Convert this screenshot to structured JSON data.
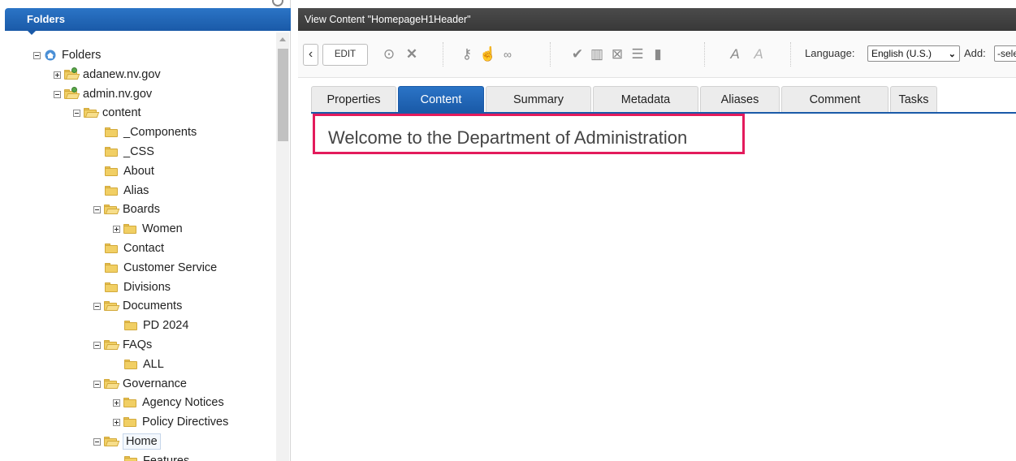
{
  "left_panel": {
    "header": "Folders",
    "tree": [
      {
        "label": "Folders",
        "icon": "home-icon",
        "expander": "minus",
        "level": 0
      },
      {
        "label": "adanew.nv.gov",
        "icon": "site-folder-icon",
        "expander": "plus",
        "level": 1
      },
      {
        "label": "admin.nv.gov",
        "icon": "site-folder-icon",
        "expander": "minus",
        "level": 1
      },
      {
        "label": "content",
        "icon": "folder-open-icon",
        "expander": "minus",
        "level": 2
      },
      {
        "label": "_Components",
        "icon": "folder-icon",
        "expander": "",
        "level": 3
      },
      {
        "label": "_CSS",
        "icon": "folder-icon",
        "expander": "",
        "level": 3
      },
      {
        "label": "About",
        "icon": "folder-icon",
        "expander": "",
        "level": 3
      },
      {
        "label": "Alias",
        "icon": "folder-icon",
        "expander": "",
        "level": 3
      },
      {
        "label": "Boards",
        "icon": "folder-open-icon",
        "expander": "minus",
        "level": 3
      },
      {
        "label": "Women",
        "icon": "folder-icon",
        "expander": "plus",
        "level": 4
      },
      {
        "label": "Contact",
        "icon": "folder-icon",
        "expander": "",
        "level": 3
      },
      {
        "label": "Customer Service",
        "icon": "folder-icon",
        "expander": "",
        "level": 3
      },
      {
        "label": "Divisions",
        "icon": "folder-icon",
        "expander": "",
        "level": 3
      },
      {
        "label": "Documents",
        "icon": "folder-open-icon",
        "expander": "minus",
        "level": 3
      },
      {
        "label": "PD 2024",
        "icon": "folder-icon",
        "expander": "",
        "level": 4
      },
      {
        "label": "FAQs",
        "icon": "folder-open-icon",
        "expander": "minus",
        "level": 3
      },
      {
        "label": "ALL",
        "icon": "folder-icon",
        "expander": "",
        "level": 4
      },
      {
        "label": "Governance",
        "icon": "folder-open-icon",
        "expander": "minus",
        "level": 3
      },
      {
        "label": "Agency Notices",
        "icon": "folder-icon",
        "expander": "plus",
        "level": 4
      },
      {
        "label": "Policy Directives",
        "icon": "folder-icon",
        "expander": "plus",
        "level": 4
      },
      {
        "label": "Home",
        "icon": "folder-open-icon",
        "expander": "minus",
        "level": 3,
        "selected": true
      },
      {
        "label": "Features",
        "icon": "folder-icon",
        "expander": "",
        "level": 4
      }
    ]
  },
  "right_panel": {
    "title": "View Content \"HomepageH1Header\"",
    "toolbar": {
      "back_icon": "chevron-left-icon",
      "edit_label": "EDIT",
      "language_label": "Language:",
      "language_value": "English (U.S.)",
      "add_label": "Add:",
      "add_value": "-select-"
    },
    "tabs": [
      "Properties",
      "Content",
      "Summary",
      "Metadata",
      "Aliases",
      "Comment",
      "Tasks"
    ],
    "active_tab": "Content",
    "content_text": "Welcome to the Department of Administration",
    "highlight_color": "#e31b5c"
  }
}
